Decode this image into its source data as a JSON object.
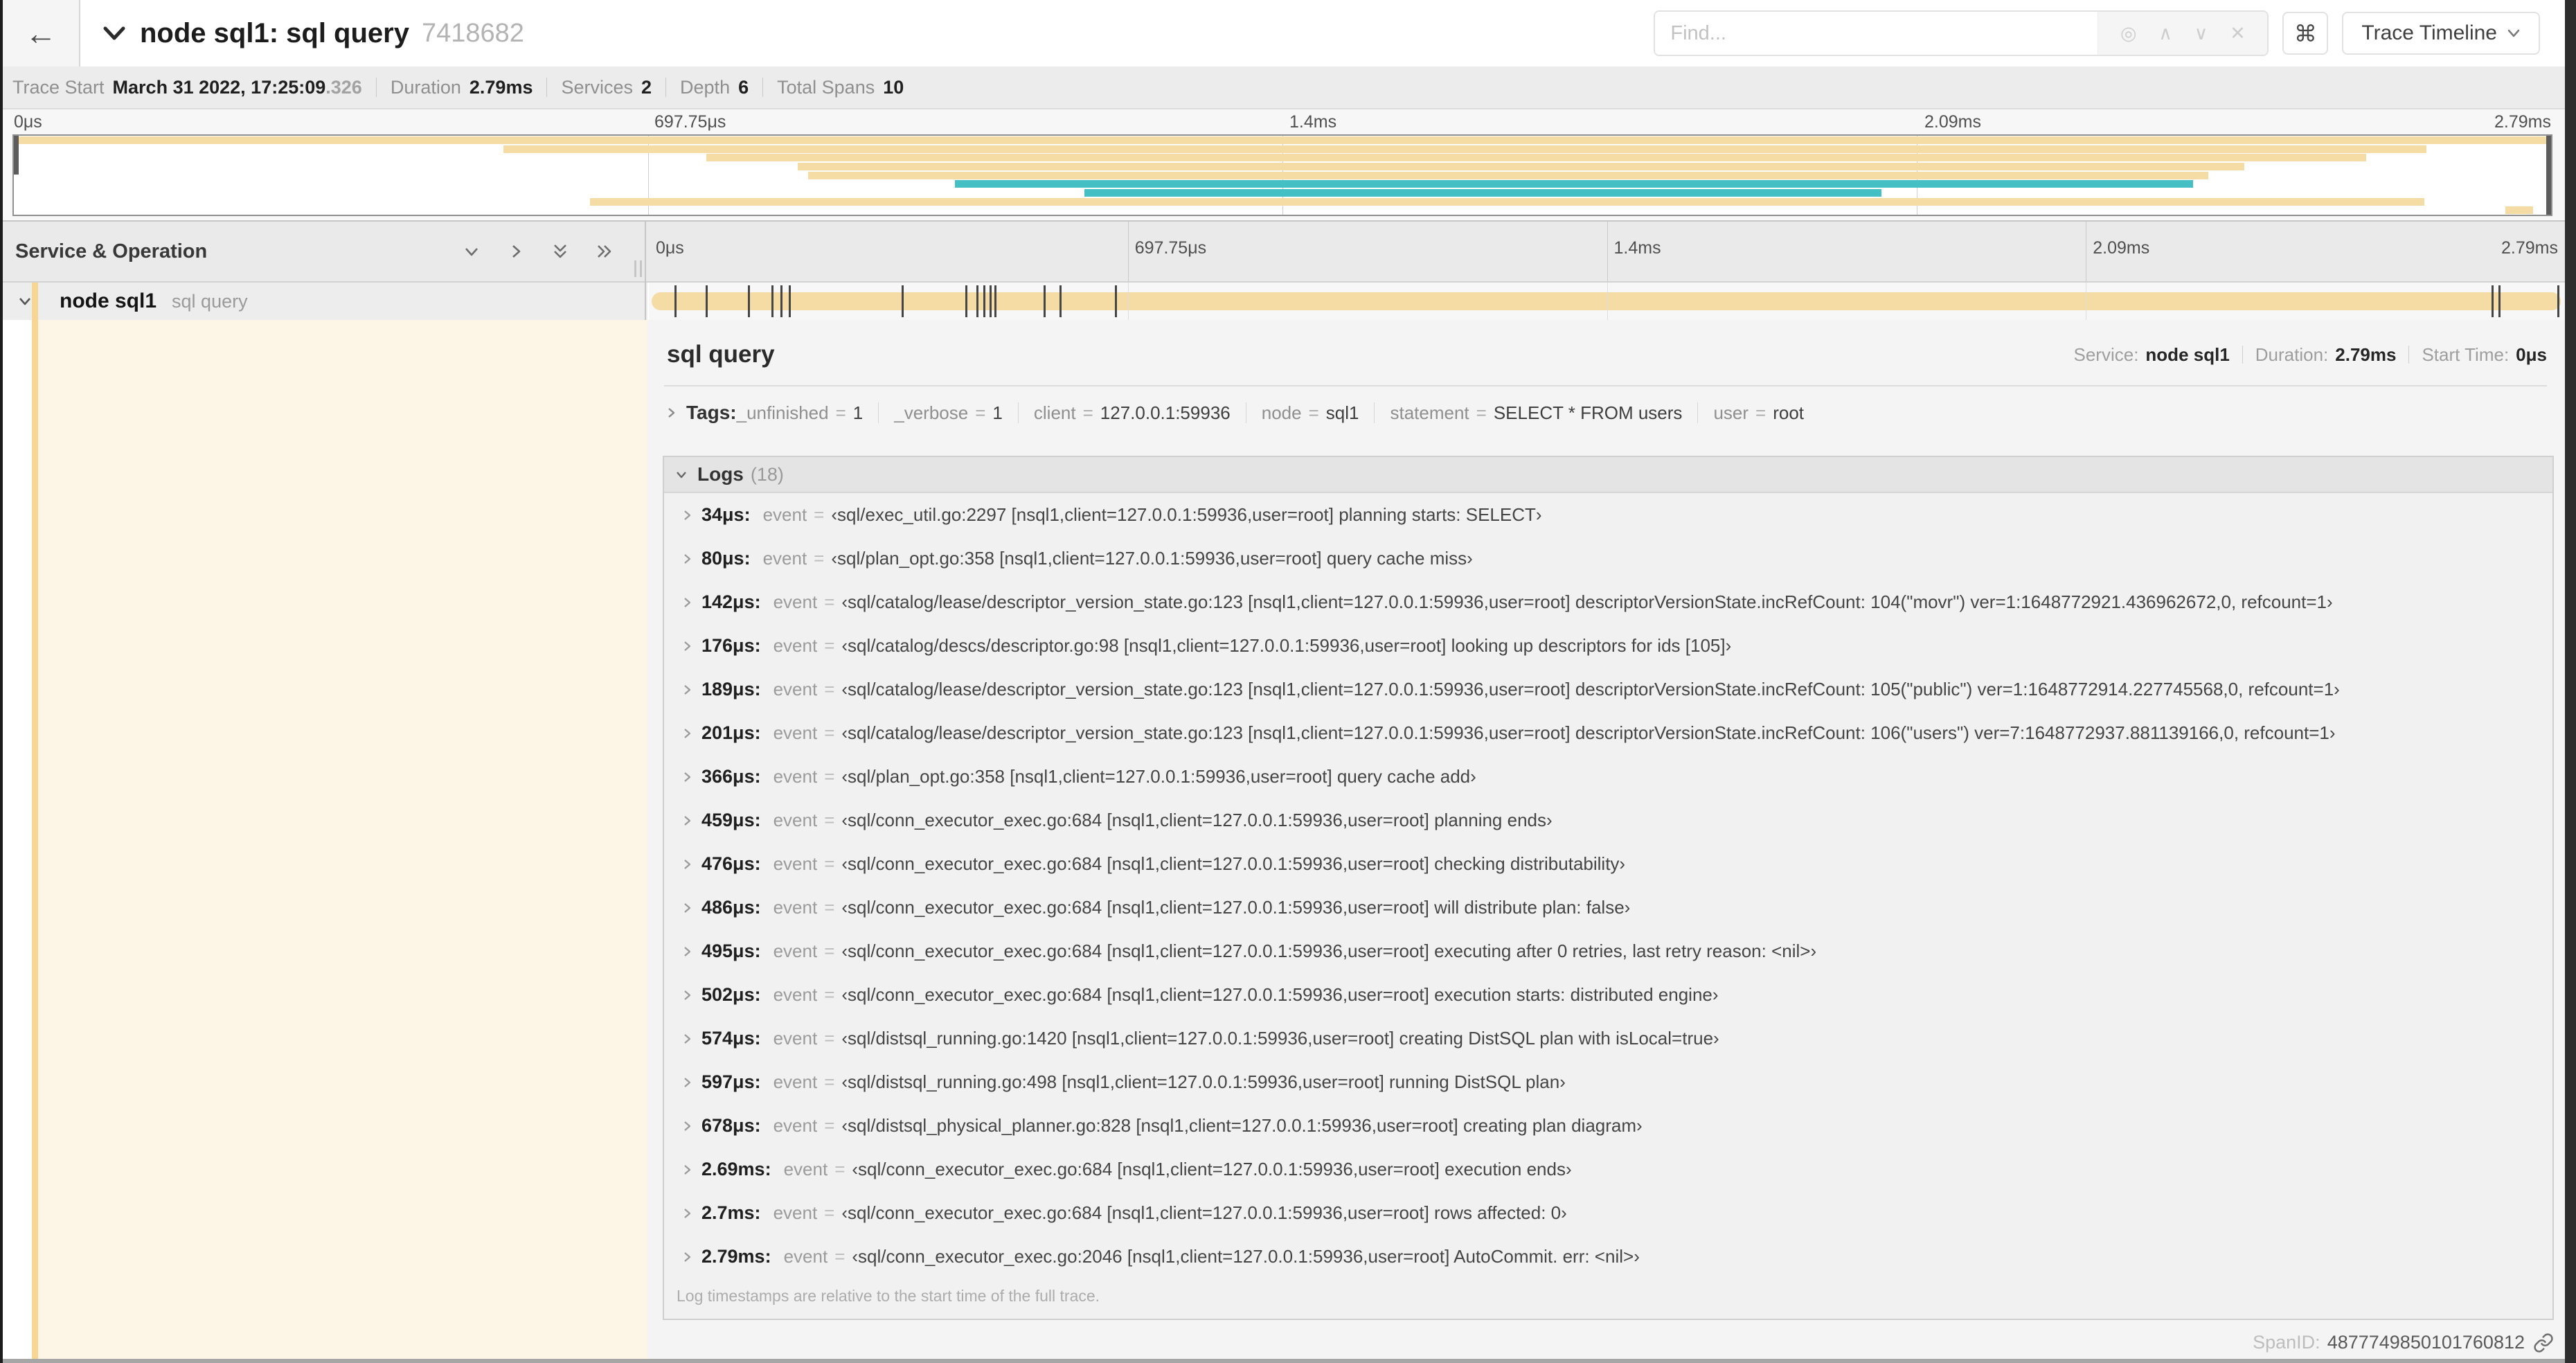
{
  "header": {
    "title": "node sql1: sql query",
    "trace_id": "7418682",
    "find_placeholder": "Find...",
    "view_selector_label": "Trace Timeline"
  },
  "icons": {
    "back": "←",
    "command_key": "⌘",
    "find_target": "◎",
    "find_prev": "∧",
    "find_next": "∨",
    "find_clear": "✕"
  },
  "summary": {
    "items": [
      {
        "label": "Trace Start",
        "value": "March 31 2022, 17:25:09",
        "suffix": ".326"
      },
      {
        "label": "Duration",
        "value": "2.79ms"
      },
      {
        "label": "Services",
        "value": "2"
      },
      {
        "label": "Depth",
        "value": "6"
      },
      {
        "label": "Total Spans",
        "value": "10"
      }
    ]
  },
  "colors": {
    "span_tan": "#f5dba4",
    "span_teal": "#44c0c5",
    "stripe_tan": "#f6d692",
    "detail_cream": "#fdf5e6"
  },
  "time_ticks": [
    {
      "label": "0μs",
      "pct": 0
    },
    {
      "label": "697.75μs",
      "pct": 25
    },
    {
      "label": "1.4ms",
      "pct": 50
    },
    {
      "label": "2.09ms",
      "pct": 75
    },
    {
      "label": "2.79ms",
      "pct": 100
    }
  ],
  "minimap": {
    "spans": [
      {
        "row": 0,
        "start": 0,
        "end": 100,
        "color": "tan"
      },
      {
        "row": 1,
        "start": 19.3,
        "end": 95.1,
        "color": "tan"
      },
      {
        "row": 2,
        "start": 27.3,
        "end": 92.7,
        "color": "tan"
      },
      {
        "row": 3,
        "start": 30.9,
        "end": 87.9,
        "color": "tan"
      },
      {
        "row": 4,
        "start": 31.3,
        "end": 86.5,
        "color": "tan"
      },
      {
        "row": 5,
        "start": 37.1,
        "end": 85.9,
        "color": "teal"
      },
      {
        "row": 6,
        "start": 42.2,
        "end": 73.6,
        "color": "teal"
      },
      {
        "row": 7,
        "start": 22.7,
        "end": 95.0,
        "color": "tan"
      },
      {
        "row": 8,
        "start": 98.2,
        "end": 99.3,
        "color": "tan"
      }
    ]
  },
  "timeline": {
    "left_header": "Service & Operation",
    "row": {
      "service": "node sql1",
      "operation": "sql query",
      "log_marks_pct": [
        1.22,
        2.87,
        5.09,
        6.31,
        6.77,
        7.2,
        13.12,
        16.45,
        17.06,
        17.42,
        17.74,
        18.0,
        20.57,
        21.4,
        24.3,
        96.42,
        96.77,
        99.85
      ]
    }
  },
  "detail": {
    "title": "sql query",
    "meta": [
      {
        "label": "Service:",
        "value": "node sql1"
      },
      {
        "label": "Duration:",
        "value": "2.79ms"
      },
      {
        "label": "Start Time:",
        "value": "0μs"
      }
    ],
    "tags": {
      "label": "Tags:",
      "equals": "=",
      "items": [
        {
          "key": "_unfinished",
          "value": "1"
        },
        {
          "key": "_verbose",
          "value": "1"
        },
        {
          "key": "client",
          "value": "127.0.0.1:59936"
        },
        {
          "key": "node",
          "value": "sql1"
        },
        {
          "key": "statement",
          "value": "SELECT * FROM users"
        },
        {
          "key": "user",
          "value": "root"
        }
      ]
    },
    "logs": {
      "label": "Logs",
      "count": "(18)",
      "field_key": "event",
      "equals": "=",
      "entries": [
        {
          "time": "34μs:",
          "value": "‹sql/exec_util.go:2297 [nsql1,client=127.0.0.1:59936,user=root] planning starts: SELECT›"
        },
        {
          "time": "80μs:",
          "value": "‹sql/plan_opt.go:358 [nsql1,client=127.0.0.1:59936,user=root] query cache miss›"
        },
        {
          "time": "142μs:",
          "value": "‹sql/catalog/lease/descriptor_version_state.go:123 [nsql1,client=127.0.0.1:59936,user=root] descriptorVersionState.incRefCount: 104(\"movr\") ver=1:1648772921.436962672,0, refcount=1›"
        },
        {
          "time": "176μs:",
          "value": "‹sql/catalog/descs/descriptor.go:98 [nsql1,client=127.0.0.1:59936,user=root] looking up descriptors for ids [105]›"
        },
        {
          "time": "189μs:",
          "value": "‹sql/catalog/lease/descriptor_version_state.go:123 [nsql1,client=127.0.0.1:59936,user=root] descriptorVersionState.incRefCount: 105(\"public\") ver=1:1648772914.227745568,0, refcount=1›"
        },
        {
          "time": "201μs:",
          "value": "‹sql/catalog/lease/descriptor_version_state.go:123 [nsql1,client=127.0.0.1:59936,user=root] descriptorVersionState.incRefCount: 106(\"users\") ver=7:1648772937.881139166,0, refcount=1›"
        },
        {
          "time": "366μs:",
          "value": "‹sql/plan_opt.go:358 [nsql1,client=127.0.0.1:59936,user=root] query cache add›"
        },
        {
          "time": "459μs:",
          "value": "‹sql/conn_executor_exec.go:684 [nsql1,client=127.0.0.1:59936,user=root] planning ends›"
        },
        {
          "time": "476μs:",
          "value": "‹sql/conn_executor_exec.go:684 [nsql1,client=127.0.0.1:59936,user=root] checking distributability›"
        },
        {
          "time": "486μs:",
          "value": "‹sql/conn_executor_exec.go:684 [nsql1,client=127.0.0.1:59936,user=root] will distribute plan: false›"
        },
        {
          "time": "495μs:",
          "value": "‹sql/conn_executor_exec.go:684 [nsql1,client=127.0.0.1:59936,user=root] executing after 0 retries, last retry reason: <nil>›"
        },
        {
          "time": "502μs:",
          "value": "‹sql/conn_executor_exec.go:684 [nsql1,client=127.0.0.1:59936,user=root] execution starts: distributed engine›"
        },
        {
          "time": "574μs:",
          "value": "‹sql/distsql_running.go:1420 [nsql1,client=127.0.0.1:59936,user=root] creating DistSQL plan with isLocal=true›"
        },
        {
          "time": "597μs:",
          "value": "‹sql/distsql_running.go:498 [nsql1,client=127.0.0.1:59936,user=root] running DistSQL plan›"
        },
        {
          "time": "678μs:",
          "value": "‹sql/distsql_physical_planner.go:828 [nsql1,client=127.0.0.1:59936,user=root] creating plan diagram›"
        },
        {
          "time": "2.69ms:",
          "value": "‹sql/conn_executor_exec.go:684 [nsql1,client=127.0.0.1:59936,user=root] execution ends›"
        },
        {
          "time": "2.7ms:",
          "value": "‹sql/conn_executor_exec.go:684 [nsql1,client=127.0.0.1:59936,user=root] rows affected: 0›"
        },
        {
          "time": "2.79ms:",
          "value": "‹sql/conn_executor_exec.go:2046 [nsql1,client=127.0.0.1:59936,user=root] AutoCommit. err: <nil>›"
        }
      ],
      "footnote": "Log timestamps are relative to the start time of the full trace."
    },
    "span_id_label": "SpanID:",
    "span_id": "4877749850101760812"
  }
}
